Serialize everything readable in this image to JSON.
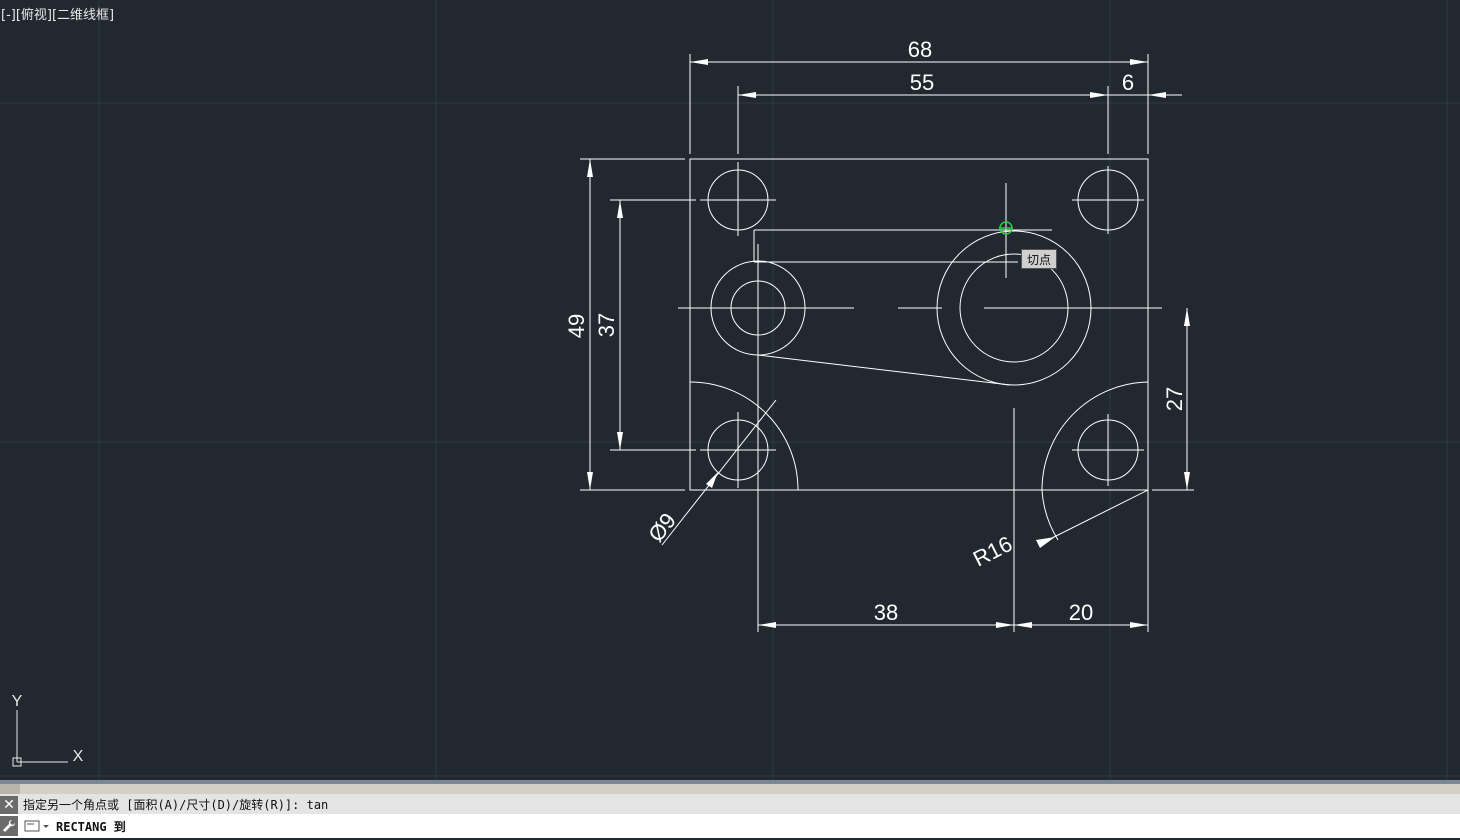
{
  "viewport": {
    "label": "[-][俯视][二维线框]",
    "background": "#212830"
  },
  "drawing": {
    "dimensions": {
      "overall_width": "68",
      "hole_spacing": "55",
      "hole_offset": "6",
      "overall_height": "49",
      "hole_vertical_spacing": "37",
      "right_height": "27",
      "hole_diameter": "Ø9",
      "corner_radius": "R16",
      "bottom_left": "38",
      "bottom_right": "20"
    },
    "snap_tooltip": "切点"
  },
  "ucs": {
    "x_label": "X",
    "y_label": "Y"
  },
  "command_line": {
    "history": "指定另一个角点或 [面积(A)/尺寸(D)/旋转(R)]: tan",
    "input_value": "RECTANG 到",
    "close_glyph": "✕",
    "wrench_glyph": "🔧"
  }
}
